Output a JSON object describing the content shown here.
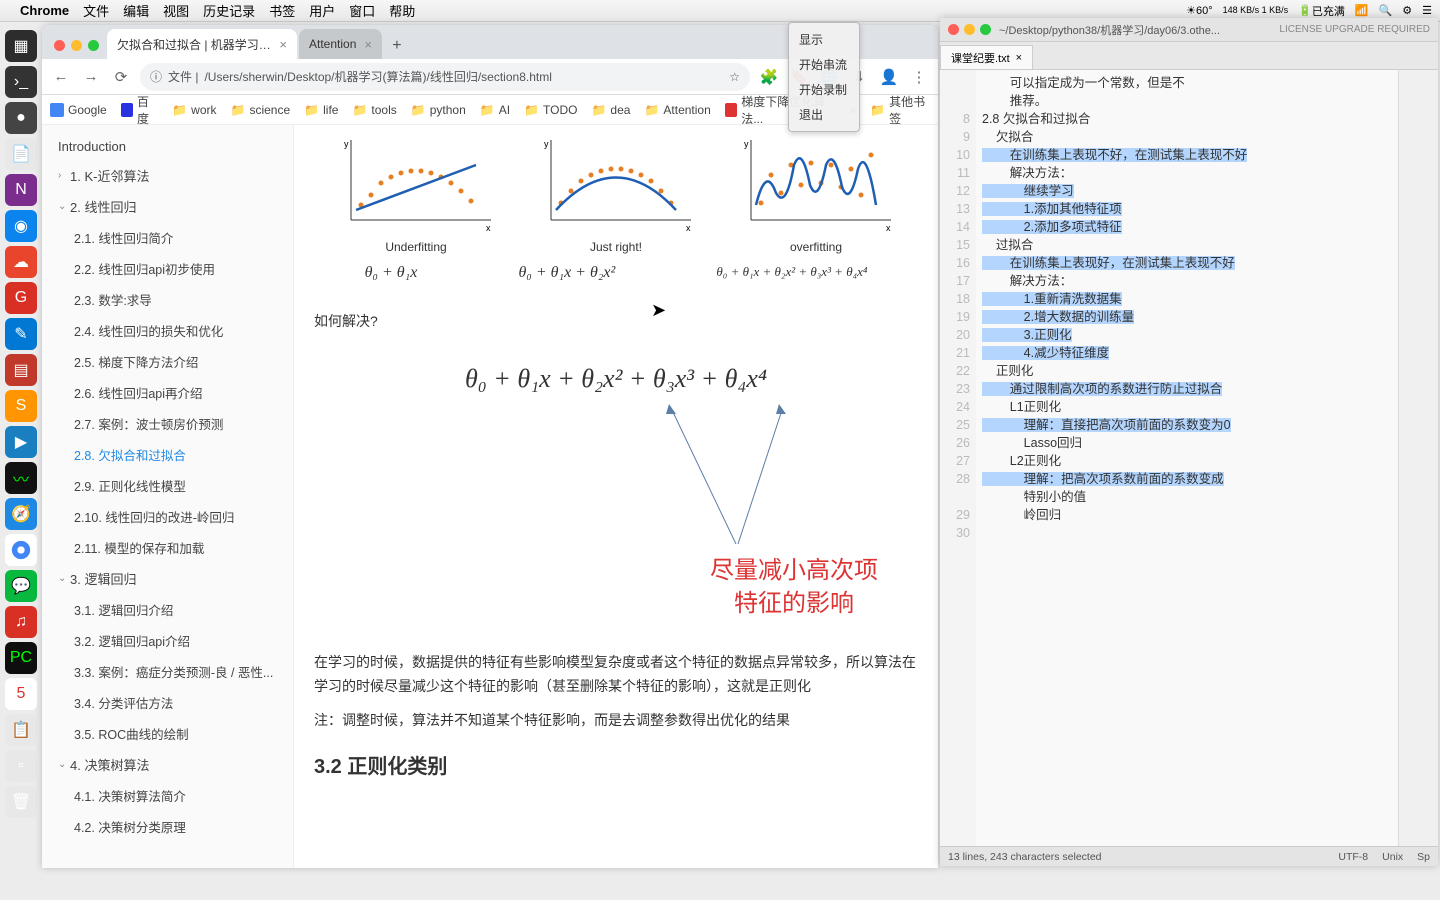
{
  "menubar": {
    "app": "Chrome",
    "items": [
      "文件",
      "编辑",
      "视图",
      "历史记录",
      "书签",
      "用户",
      "窗口",
      "帮助"
    ],
    "status": {
      "temp": "60°",
      "net": "148 KB/s\n1 KB/s",
      "bat": "已充满"
    }
  },
  "dropdown": {
    "items": [
      "显示",
      "开始串流",
      "开始录制",
      "退出"
    ]
  },
  "chrome": {
    "tabs": [
      {
        "title": "欠拟合和过拟合 | 机器学习算法",
        "active": true
      },
      {
        "title": "Attention",
        "active": false
      }
    ],
    "url_prefix": "文件 | ",
    "url": "/Users/sherwin/Desktop/机器学习(算法篇)/线性回归/section8.html",
    "bookmarks": [
      "Google",
      "百度",
      "work",
      "science",
      "life",
      "tools",
      "python",
      "AI",
      "TODO",
      "dea",
      "Attention",
      "梯度下降优化算法..."
    ],
    "bookmarks_more": "»",
    "bookmarks_other": "其他书签"
  },
  "sidebar": {
    "intro": "Introduction",
    "groups": [
      {
        "num": "1.",
        "label": "K-近邻算法",
        "open": false,
        "children": []
      },
      {
        "num": "2.",
        "label": "线性回归",
        "open": true,
        "children": [
          {
            "num": "2.1.",
            "label": "线性回归简介"
          },
          {
            "num": "2.2.",
            "label": "线性回归api初步使用"
          },
          {
            "num": "2.3.",
            "label": "数学:求导"
          },
          {
            "num": "2.4.",
            "label": "线性回归的损失和优化"
          },
          {
            "num": "2.5.",
            "label": "梯度下降方法介绍"
          },
          {
            "num": "2.6.",
            "label": "线性回归api再介绍"
          },
          {
            "num": "2.7.",
            "label": "案例：波士顿房价预测"
          },
          {
            "num": "2.8.",
            "label": "欠拟合和过拟合",
            "active": true
          },
          {
            "num": "2.9.",
            "label": "正则化线性模型"
          },
          {
            "num": "2.10.",
            "label": "线性回归的改进-岭回归"
          },
          {
            "num": "2.11.",
            "label": "模型的保存和加载"
          }
        ]
      },
      {
        "num": "3.",
        "label": "逻辑回归",
        "open": true,
        "children": [
          {
            "num": "3.1.",
            "label": "逻辑回归介绍"
          },
          {
            "num": "3.2.",
            "label": "逻辑回归api介绍"
          },
          {
            "num": "3.3.",
            "label": "案例：癌症分类预测-良 / 恶性..."
          },
          {
            "num": "3.4.",
            "label": "分类评估方法"
          },
          {
            "num": "3.5.",
            "label": "ROC曲线的绘制"
          }
        ]
      },
      {
        "num": "4.",
        "label": "决策树算法",
        "open": true,
        "children": [
          {
            "num": "4.1.",
            "label": "决策树算法简介"
          },
          {
            "num": "4.2.",
            "label": "决策树分类原理"
          }
        ]
      }
    ]
  },
  "main": {
    "plots": [
      {
        "cap": "Underfitting",
        "f": "θ₀ + θ₁x"
      },
      {
        "cap": "Just right!",
        "f": "θ₀ + θ₁x + θ₂x²"
      },
      {
        "cap": "overfitting",
        "f": "θ₀ + θ₁x + θ₂x² + θ₃x³ + θ₄x⁴"
      }
    ],
    "q": "如何解决?",
    "bigf": "θ₀ + θ₁x + θ₂x² + θ₃x³ + θ₄x⁴",
    "red1": "尽量减小高次项",
    "red2": "特征的影响",
    "para1": "在学习的时候，数据提供的特征有些影响模型复杂度或者这个特征的数据点异常较多，所以算法在学习的时候尽量减少这个特征的影响（甚至删除某个特征的影响），这就是正则化",
    "para2": "注：调整时候，算法并不知道某个特征影响，而是去调整参数得出优化的结果",
    "h3": "3.2 正则化类别"
  },
  "sublime": {
    "path": "~/Desktop/python38/机器学习/day06/3.othe...",
    "license": "LICENSE UPGRADE REQUIRED",
    "tab": "课堂纪要.txt",
    "lines": [
      {
        "n": "",
        "t": "        可以指定成为一个常数，但是不"
      },
      {
        "n": "",
        "t": "        推荐。"
      },
      {
        "n": "8",
        "t": "2.8 欠拟合和过拟合"
      },
      {
        "n": "9",
        "t": "    欠拟合"
      },
      {
        "n": "10",
        "t": "        在训练集上表现不好，在测试集上表现不好",
        "hl": true
      },
      {
        "n": "11",
        "t": "        解决方法："
      },
      {
        "n": "12",
        "t": "            继续学习",
        "hl": true
      },
      {
        "n": "13",
        "t": "            1.添加其他特征项",
        "hl": true
      },
      {
        "n": "14",
        "t": "            2.添加多项式特征",
        "hl": true
      },
      {
        "n": "15",
        "t": "    过拟合"
      },
      {
        "n": "16",
        "t": "        在训练集上表现好，在测试集上表现不好",
        "hl": true
      },
      {
        "n": "17",
        "t": "        解决方法："
      },
      {
        "n": "18",
        "t": "            1.重新清洗数据集",
        "hl": true
      },
      {
        "n": "19",
        "t": "            2.增大数据的训练量",
        "hl": true
      },
      {
        "n": "20",
        "t": "            3.正则化",
        "hl": true
      },
      {
        "n": "21",
        "t": "            4.减少特征维度",
        "hl": true
      },
      {
        "n": "22",
        "t": "    正则化"
      },
      {
        "n": "23",
        "t": "        通过限制高次项的系数进行防止过拟合",
        "hl": true
      },
      {
        "n": "24",
        "t": "        L1正则化"
      },
      {
        "n": "25",
        "t": "            理解：直接把高次项前面的系数变为0",
        "hl": true
      },
      {
        "n": "26",
        "t": "            Lasso回归"
      },
      {
        "n": "27",
        "t": "        L2正则化"
      },
      {
        "n": "28",
        "t": "            理解：把高次项系数前面的系数变成",
        "hl": true
      },
      {
        "n": "",
        "t": "            特别小的值"
      },
      {
        "n": "29",
        "t": "            岭回归"
      },
      {
        "n": "30",
        "t": ""
      }
    ],
    "status": {
      "sel": "13 lines, 243 characters selected",
      "enc": "UTF-8",
      "le": "Unix",
      "syntax": "Sp"
    }
  }
}
